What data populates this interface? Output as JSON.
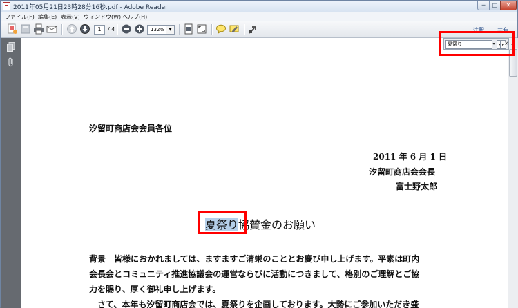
{
  "window": {
    "title": "2011年05月21日23時28分16秒.pdf - Adobe Reader",
    "minimize": "─",
    "maximize": "□",
    "close": "✕"
  },
  "menu": [
    "ファイル(F)",
    "編集(E)",
    "表示(V)",
    "ウィンドウ(W)",
    "ヘルプ(H)"
  ],
  "toolbar": {
    "page_current": "1",
    "page_total": "/ 4",
    "zoom": "132%",
    "comment_label": "注釈",
    "share_label": "共有"
  },
  "find": {
    "value": "夏祭り",
    "dropdown": "▾",
    "prev": "◂",
    "next": "▸",
    "close": "×"
  },
  "document": {
    "addressee": "汐留町商店会会員各位",
    "date": "2011 年 6 月 1 日",
    "sender_org": "汐留町商店会会長",
    "sender_name": "富士野太郎",
    "heading_highlight": "夏祭り",
    "heading_rest": "協賛金のお願い",
    "body_line1": "背景　皆様におかれましては、ますますご清栄のこととお慶び申し上げます。平素は町内",
    "body_line2": "会長会とコミュニティ推進協議会の運営ならびに活動につきまして、格別のご理解とご協",
    "body_line3": "力を賜り、厚く御礼申し上げます。",
    "body_line4": "　さて、本年も汐留町商店会では、夏祭りを企画しております。大勢にご参加いただき盛"
  },
  "colors": {
    "highlight": "#b4cfe9",
    "annotation_box": "#ff0000"
  }
}
